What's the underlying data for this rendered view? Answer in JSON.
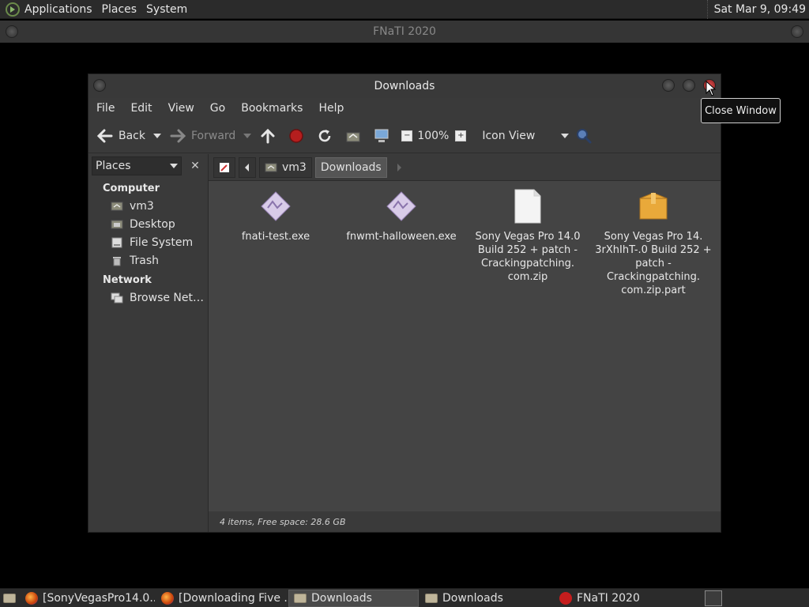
{
  "top_panel": {
    "menus": [
      "Applications",
      "Places",
      "System"
    ],
    "clock": "Sat Mar  9, 09:49"
  },
  "background_window": {
    "title": "FNaTI 2020"
  },
  "file_manager": {
    "title": "Downloads",
    "menubar": [
      "File",
      "Edit",
      "View",
      "Go",
      "Bookmarks",
      "Help"
    ],
    "toolbar": {
      "back": "Back",
      "forward": "Forward",
      "zoom": "100%",
      "view_mode": "Icon View"
    },
    "sidebar": {
      "combo": "Places",
      "sections": [
        {
          "title": "Computer",
          "items": [
            {
              "label": "vm3",
              "icon": "home-folder-icon"
            },
            {
              "label": "Desktop",
              "icon": "desktop-icon"
            },
            {
              "label": "File System",
              "icon": "drive-icon"
            },
            {
              "label": "Trash",
              "icon": "trash-icon"
            }
          ]
        },
        {
          "title": "Network",
          "items": [
            {
              "label": "Browse Net…",
              "icon": "network-icon"
            }
          ]
        }
      ]
    },
    "breadcrumbs": [
      "vm3",
      "Downloads"
    ],
    "files": [
      {
        "name": "fnati-test.exe",
        "icon": "executable-icon"
      },
      {
        "name": "fnwmt-halloween.exe",
        "icon": "executable-icon"
      },
      {
        "name": "Sony Vegas Pro 14.0 Build 252 + patch - Crackingpatching. com.zip",
        "icon": "blank-file-icon"
      },
      {
        "name": "Sony Vegas Pro 14. 3rXhIhT-.0 Build 252 + patch - Crackingpatching. com.zip.part",
        "icon": "package-icon"
      }
    ],
    "status": "4 items, Free space: 28.6 GB"
  },
  "tooltip": "Close Window",
  "taskbar": [
    {
      "label": "[SonyVegasPro14.0...",
      "icon": "firefox-icon",
      "active": false
    },
    {
      "label": "[Downloading Five ...",
      "icon": "firefox-icon",
      "active": false
    },
    {
      "label": "Downloads",
      "icon": "folder-icon",
      "active": true
    },
    {
      "label": "Downloads",
      "icon": "folder-icon",
      "active": false
    },
    {
      "label": "FNaTI 2020",
      "icon": "app-icon",
      "active": false
    }
  ]
}
